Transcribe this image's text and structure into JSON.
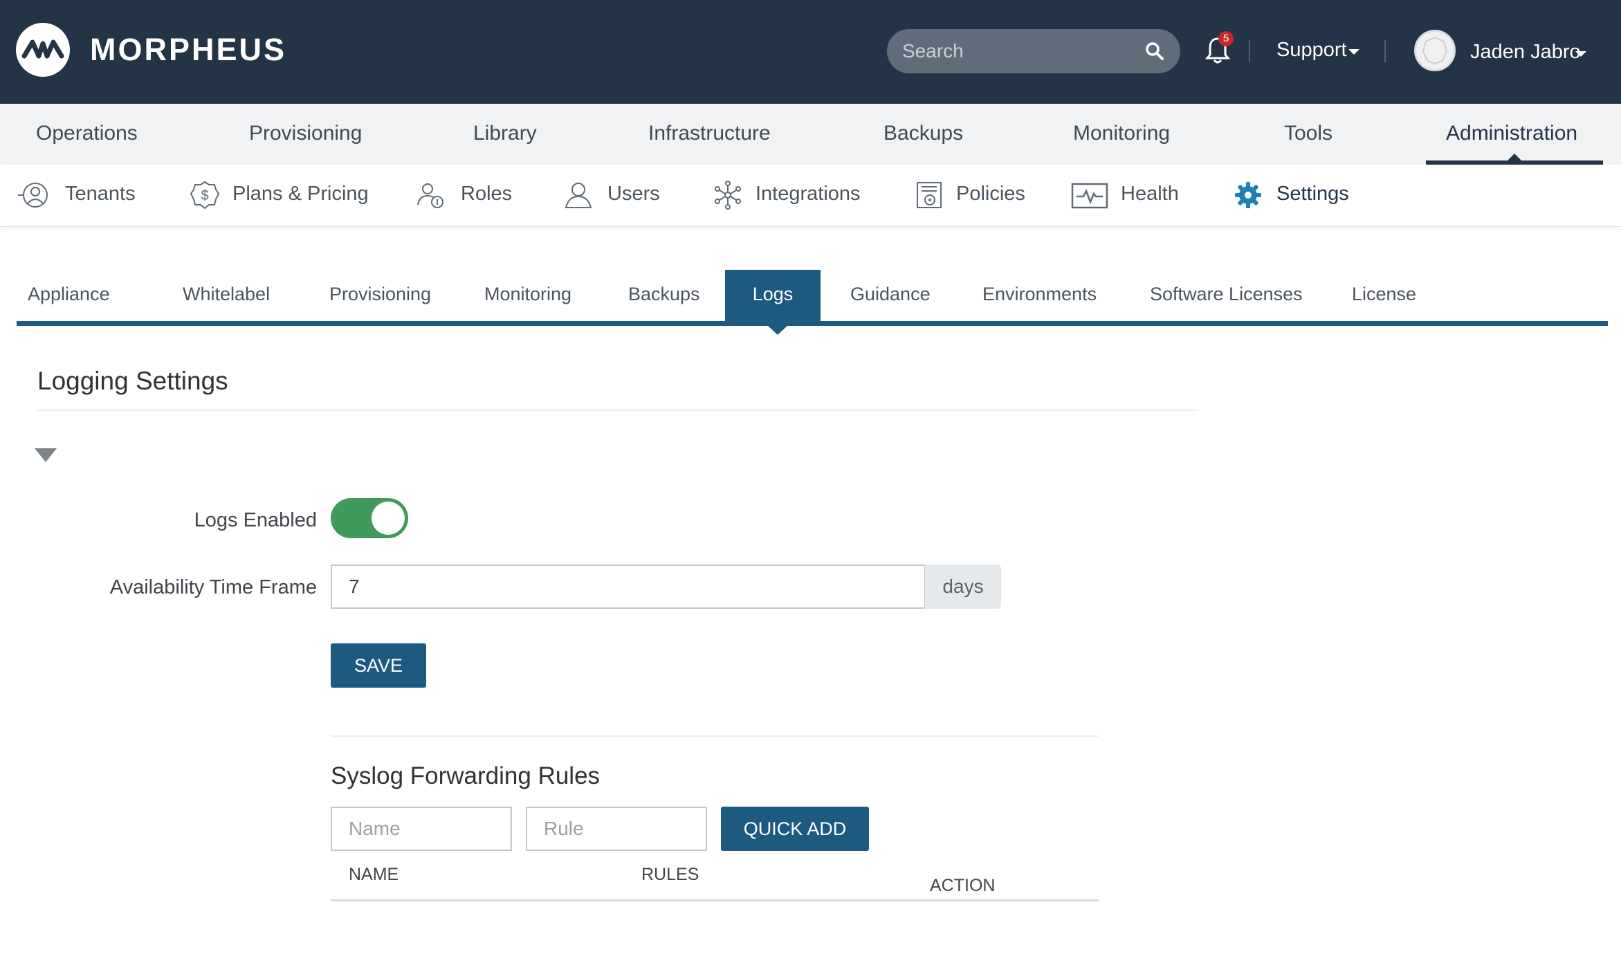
{
  "header": {
    "brand": "MORPHEUS",
    "search_placeholder": "Search",
    "notification_count": "5",
    "support_label": "Support",
    "user_name": "Jaden Jabro"
  },
  "main_nav": {
    "items": [
      "Operations",
      "Provisioning",
      "Library",
      "Infrastructure",
      "Backups",
      "Monitoring",
      "Tools",
      "Administration"
    ],
    "active": "Administration"
  },
  "sub_nav": {
    "items": [
      {
        "label": "Tenants",
        "icon": "tenants-icon"
      },
      {
        "label": "Plans & Pricing",
        "icon": "dollar-icon"
      },
      {
        "label": "Roles",
        "icon": "roles-icon"
      },
      {
        "label": "Users",
        "icon": "user-icon"
      },
      {
        "label": "Integrations",
        "icon": "integrations-icon"
      },
      {
        "label": "Policies",
        "icon": "policies-icon"
      },
      {
        "label": "Health",
        "icon": "health-icon"
      },
      {
        "label": "Settings",
        "icon": "gear-icon"
      }
    ],
    "active": "Settings"
  },
  "tabs": {
    "items": [
      "Appliance",
      "Whitelabel",
      "Provisioning",
      "Monitoring",
      "Backups",
      "Logs",
      "Guidance",
      "Environments",
      "Software Licenses",
      "License"
    ],
    "active": "Logs"
  },
  "page": {
    "title": "Logging Settings",
    "logs_enabled_label": "Logs Enabled",
    "logs_enabled": true,
    "availability_label": "Availability Time Frame",
    "availability_value": "7",
    "availability_unit": "days",
    "save_label": "SAVE"
  },
  "syslog": {
    "title": "Syslog Forwarding Rules",
    "name_placeholder": "Name",
    "rule_placeholder": "Rule",
    "quick_add_label": "QUICK ADD",
    "columns": [
      "NAME",
      "RULES",
      "ACTION"
    ]
  },
  "colors": {
    "header_bg": "#233447",
    "accent": "#1c5a80",
    "toggle_on": "#3f9a5c",
    "badge": "#c8282d"
  }
}
